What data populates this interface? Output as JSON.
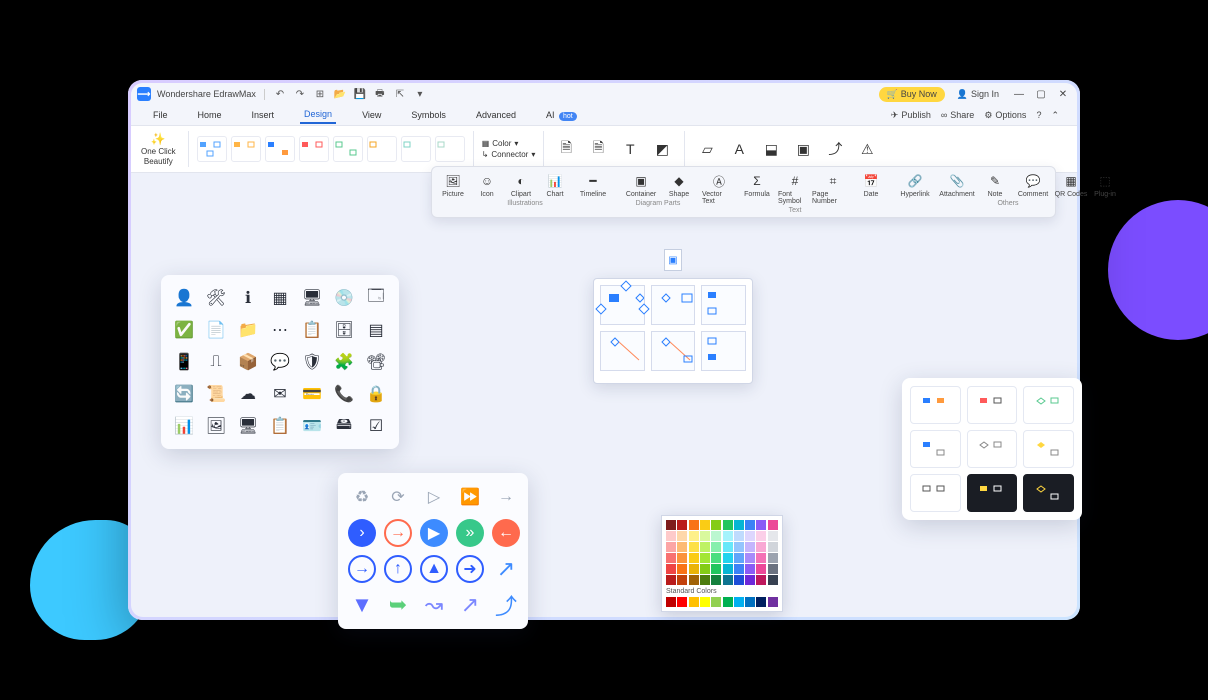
{
  "app": {
    "title": "Wondershare EdrawMax"
  },
  "titlebar": {
    "buy": "Buy Now",
    "signin": "Sign In"
  },
  "menu": {
    "items": [
      "File",
      "Home",
      "Insert",
      "Design",
      "View",
      "Symbols",
      "Advanced",
      "AI"
    ],
    "active": "Design",
    "hot": "hot"
  },
  "right_actions": {
    "publish": "Publish",
    "share": "Share",
    "options": "Options"
  },
  "ribbon": {
    "beautify_l1": "One Click",
    "beautify_l2": "Beautify",
    "color": "Color",
    "connector": "Connector"
  },
  "insert_bar": {
    "groups": [
      {
        "title": "Illustrations",
        "items": [
          "Picture",
          "Icon",
          "Clipart",
          "Chart",
          "Timeline"
        ]
      },
      {
        "title": "Diagram Parts",
        "items": [
          "Container",
          "Shape"
        ]
      },
      {
        "title": "Text",
        "items": [
          "Vector Text",
          "Formula",
          "Font Symbol",
          "Page Number",
          "Date"
        ]
      },
      {
        "title": "Others",
        "items": [
          "Hyperlink",
          "Attachment",
          "Note",
          "Comment",
          "QR Codes",
          "Plug-in"
        ]
      }
    ]
  },
  "color_panel": {
    "standard_label": "Standard Colors",
    "theme_rows": [
      [
        "#7f1d1d",
        "#b91c1c",
        "#f97316",
        "#facc15",
        "#84cc16",
        "#22c55e",
        "#06b6d4",
        "#3b82f6",
        "#8b5cf6",
        "#ec4899"
      ],
      [
        "#fecaca",
        "#fed7aa",
        "#fef08a",
        "#d9f99d",
        "#bbf7d0",
        "#a5f3fc",
        "#bfdbfe",
        "#ddd6fe",
        "#fbcfe8",
        "#e5e7eb"
      ],
      [
        "#fca5a5",
        "#fdba74",
        "#fde047",
        "#bef264",
        "#86efac",
        "#67e8f9",
        "#93c5fd",
        "#c4b5fd",
        "#f9a8d4",
        "#d1d5db"
      ],
      [
        "#f87171",
        "#fb923c",
        "#facc15",
        "#a3e635",
        "#4ade80",
        "#22d3ee",
        "#60a5fa",
        "#a78bfa",
        "#f472b6",
        "#9ca3af"
      ],
      [
        "#ef4444",
        "#f97316",
        "#eab308",
        "#84cc16",
        "#22c55e",
        "#06b6d4",
        "#3b82f6",
        "#8b5cf6",
        "#ec4899",
        "#6b7280"
      ],
      [
        "#b91c1c",
        "#c2410c",
        "#a16207",
        "#4d7c0f",
        "#15803d",
        "#0e7490",
        "#1d4ed8",
        "#6d28d9",
        "#be185d",
        "#374151"
      ]
    ],
    "standard": [
      "#c00000",
      "#ff0000",
      "#ffc000",
      "#ffff00",
      "#92d050",
      "#00b050",
      "#00b0f0",
      "#0070c0",
      "#002060",
      "#7030a0"
    ]
  }
}
